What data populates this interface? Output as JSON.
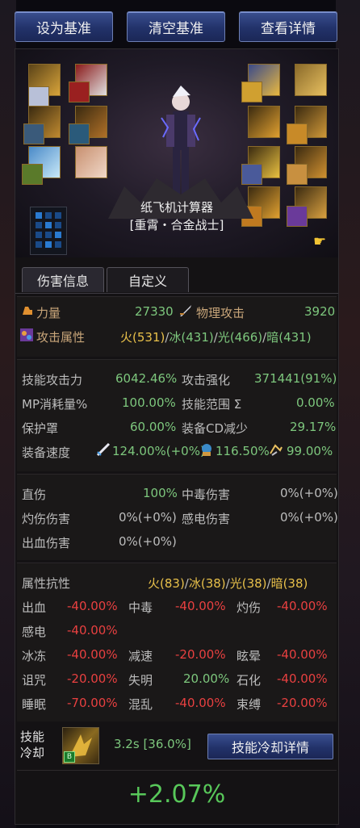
{
  "top_buttons": {
    "set_baseline": "设为基准",
    "clear_baseline": "清空基准",
    "view_details": "查看详情"
  },
  "character": {
    "calculator_title": "纸飞机计算器",
    "name": "[重霄・合金战士]"
  },
  "tabs": {
    "damage_info": "伤害信息",
    "custom": "自定义"
  },
  "stats": {
    "strength_label": "力量",
    "strength_value": "27330",
    "phys_attack_label": "物理攻击",
    "phys_attack_value": "3920",
    "element_label": "攻击属性",
    "element_fire": "火(531)",
    "element_ice": "冰(431)",
    "element_light": "光(466)",
    "element_dark": "暗(431)",
    "slash": "/"
  },
  "skills": {
    "skill_attack_label": "技能攻击力",
    "skill_attack_value": "6042.46%",
    "attack_enhance_label": "攻击强化",
    "attack_enhance_value": "371441(91%)",
    "mp_cost_label": "MP消耗量%",
    "mp_cost_value": "100.00%",
    "skill_range_label": "技能范围 Σ",
    "skill_range_value": "0.00%",
    "shield_label": "保护罩",
    "shield_value": "60.00%",
    "cd_reduce_label": "装备CD减少",
    "cd_reduce_value": "29.17%",
    "equip_speed_label": "装备速度",
    "speed1_value": "124.00%(+0%)",
    "speed2_value": "116.50%",
    "speed3_value": "99.00%"
  },
  "damage": {
    "direct_label": "直伤",
    "direct_value": "100%",
    "poison_label": "中毒伤害",
    "poison_value": "0%(+0%)",
    "burn_label": "灼伤伤害",
    "burn_value": "0%(+0%)",
    "shock_label": "感电伤害",
    "shock_value": "0%(+0%)",
    "bleed_label": "出血伤害",
    "bleed_value": "0%(+0%)"
  },
  "resist": {
    "title": "属性抗性",
    "fire": "火(83)",
    "ice": "冰(38)",
    "light": "光(38)",
    "dark": "暗(38)",
    "bleed_label": "出血",
    "bleed_value": "-40.00%",
    "poison_label": "中毒",
    "poison_value": "-40.00%",
    "burn_label": "灼伤",
    "burn_value": "-40.00%",
    "shock_label": "感电",
    "shock_value": "-40.00%",
    "freeze_label": "冰冻",
    "freeze_value": "-40.00%",
    "slow_label": "减速",
    "slow_value": "-20.00%",
    "stun_label": "眩晕",
    "stun_value": "-40.00%",
    "curse_label": "诅咒",
    "curse_value": "-20.00%",
    "blind_label": "失明",
    "blind_value": "20.00%",
    "petrify_label": "石化",
    "petrify_value": "-40.00%",
    "sleep_label": "睡眠",
    "sleep_value": "-70.00%",
    "confuse_label": "混乱",
    "confuse_value": "-40.00%",
    "bind_label": "束缚",
    "bind_value": "-20.00%"
  },
  "cooldown": {
    "label_line1": "技能",
    "label_line2": "冷却",
    "value": "3.2s [36.0%]",
    "detail_button": "技能冷却详情",
    "skill_badge": "B"
  },
  "result": "+2.07%"
}
